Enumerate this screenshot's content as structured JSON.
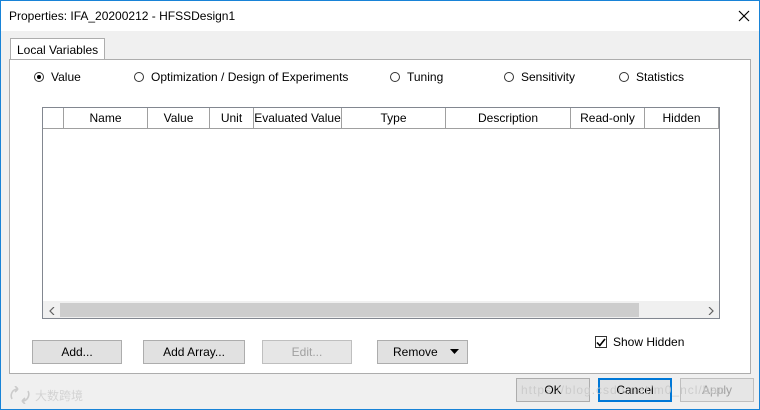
{
  "window": {
    "title": "Properties: IFA_20200212 - HFSSDesign1"
  },
  "tabs": [
    {
      "label": "Local Variables",
      "active": true
    }
  ],
  "modes": {
    "selected": "Value",
    "options": [
      {
        "label": "Value",
        "selected": true
      },
      {
        "label": "Optimization / Design of Experiments",
        "selected": false
      },
      {
        "label": "Tuning",
        "selected": false
      },
      {
        "label": "Sensitivity",
        "selected": false
      },
      {
        "label": "Statistics",
        "selected": false
      }
    ]
  },
  "table": {
    "columns": [
      "Name",
      "Value",
      "Unit",
      "Evaluated Value",
      "Type",
      "Description",
      "Read-only",
      "Hidden"
    ],
    "rows": []
  },
  "buttons": {
    "add": "Add...",
    "add_array": "Add Array...",
    "edit": "Edit...",
    "remove": "Remove",
    "ok": "OK",
    "cancel": "Cancel",
    "apply": "Apply"
  },
  "show_hidden": {
    "label": "Show Hidden",
    "checked": true
  },
  "watermark": {
    "left": "大数跨境",
    "right": "https://blog.csdn.net/m0_ncl/bac"
  }
}
